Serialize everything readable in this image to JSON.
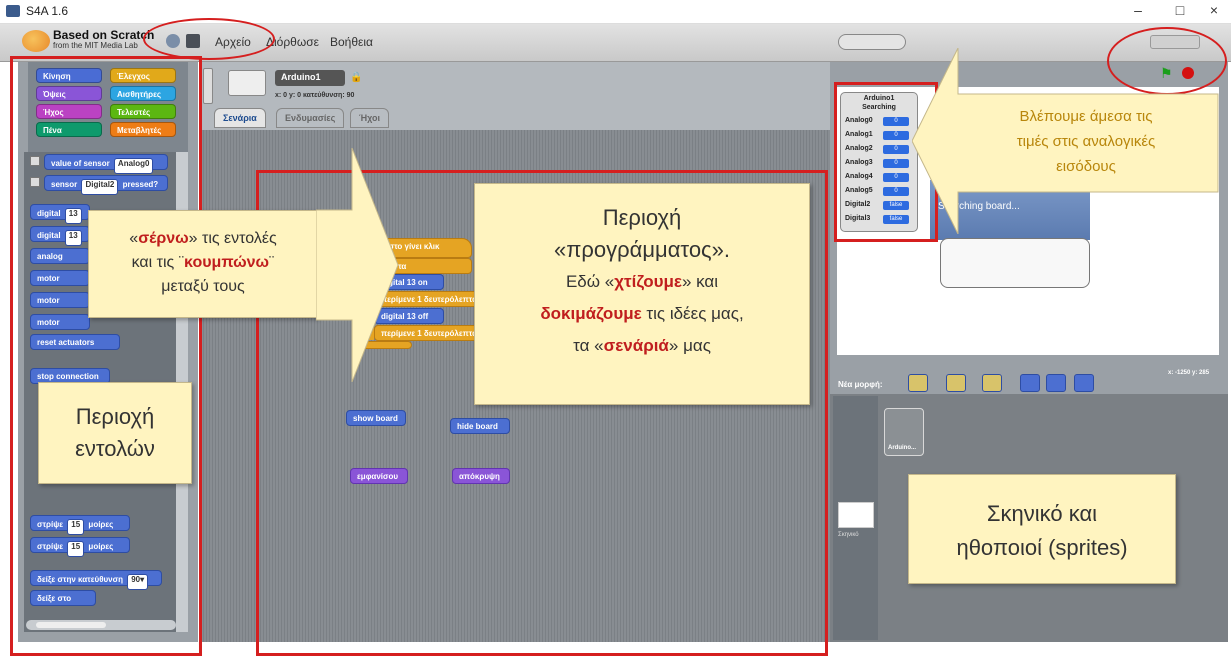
{
  "window": {
    "title": "S4A 1.6",
    "minimize": "–",
    "maximize": "□",
    "close": "×"
  },
  "menubar": {
    "logo_line1": "Based on Scratch",
    "logo_line2": "from the MIT Media Lab",
    "items": [
      "Αρχείο",
      "Διόρθωσε",
      "Βοήθεια"
    ]
  },
  "categories": [
    {
      "label": "Κίνηση",
      "color": "#4a6cd4"
    },
    {
      "label": "Έλεγχος",
      "color": "#e1a91a"
    },
    {
      "label": "Όψεις",
      "color": "#8a55d7"
    },
    {
      "label": "Αισθητήρες",
      "color": "#2ca5e2"
    },
    {
      "label": "Ήχος",
      "color": "#bb42c3"
    },
    {
      "label": "Τελεστές",
      "color": "#5cb712"
    },
    {
      "label": "Πένα",
      "color": "#0e9a6c"
    },
    {
      "label": "Μεταβλητές",
      "color": "#ee7d16"
    }
  ],
  "palette_blocks": [
    {
      "text": "value of sensor",
      "arg": "Analog0",
      "kind": "checkbox"
    },
    {
      "text": "sensor",
      "arg": "Digital2",
      "suffix": "pressed?",
      "kind": "checkbox"
    },
    {
      "text": "digital",
      "arg": "13"
    },
    {
      "text": "digital",
      "arg": "13"
    },
    {
      "text": "analog"
    },
    {
      "text": "motor"
    },
    {
      "text": "motor"
    },
    {
      "text": "motor"
    },
    {
      "text": "reset actuators"
    },
    {
      "text": "stop connection"
    },
    {
      "text": "στρίψε",
      "arg": "15",
      "suffix": "μοίρες"
    },
    {
      "text": "στρίψε",
      "arg": "15",
      "suffix": "μοίρες"
    },
    {
      "text": "δείξε στην κατεύθυνση",
      "arg": "90▾"
    },
    {
      "text": "δείξε στο"
    }
  ],
  "sprite": {
    "name": "Arduino1",
    "coords": "x: 0    y: 0    κατεύθυνση: 90"
  },
  "tabs": [
    "Σενάρια",
    "Ενδυμασίες",
    "Ήχοι"
  ],
  "script_blocks": {
    "hat": "όταν στο   γίνει κλικ",
    "forever": "για πάντα",
    "d_on": "digital  13  on",
    "wait1": "περίμενε  1  δευτερόλεπτα",
    "d_off": "digital  13  off",
    "wait2": "περίμενε  1  δευτερόλεπτα",
    "show_board": "show board",
    "hide_board": "hide board",
    "show": "εμφανίσου",
    "hide": "απόκρυψη"
  },
  "sensor_board": {
    "title1": "Arduino1",
    "title2": "Searching",
    "rows": [
      {
        "label": "Analog0",
        "value": "0"
      },
      {
        "label": "Analog1",
        "value": "0"
      },
      {
        "label": "Analog2",
        "value": "0"
      },
      {
        "label": "Analog3",
        "value": "0"
      },
      {
        "label": "Analog4",
        "value": "0"
      },
      {
        "label": "Analog5",
        "value": "0"
      },
      {
        "label": "Digital2",
        "value": "false"
      },
      {
        "label": "Digital3",
        "value": "false"
      }
    ]
  },
  "board_panel": {
    "title": "Arduino1",
    "status": "Searching board..."
  },
  "sprite_panel": {
    "new_sprite_label": "Νέα μορφή:",
    "coords": "x: -1250  y: 285",
    "sprite_item": "Arduino...",
    "stage_label": "Σκηνικό"
  },
  "callouts": {
    "drag": {
      "l1a": "«",
      "l1b": "σέρνω",
      "l1c": "» τις εντολές",
      "l2a": "και τις ¨",
      "l2b": "κουμπώνω",
      "l2c": "¨",
      "l3": "μεταξύ τους"
    },
    "commands": {
      "l1": "Περιοχή",
      "l2": "εντολών"
    },
    "program": {
      "l1": "Περιοχή",
      "l2": "«προγράμματος».",
      "l3a": "Εδώ «",
      "l3b": "χτίζουμε",
      "l3c": "» και",
      "l4a": "δοκιμάζουμε",
      "l4b": " τις ιδέες μας,",
      "l5a": "τα «",
      "l5b": "σενάριά",
      "l5c": "» μας"
    },
    "values": {
      "l1": "Βλέπουμε άμεσα τις",
      "l2": "τιμές στις αναλογικές",
      "l3": "εισόδους"
    },
    "stage": {
      "l1": "Σκηνικό  και",
      "l2": "ηθοποιοί (sprites)"
    }
  },
  "colors": {
    "highlight": "#d51f1f",
    "callout_bg": "#fff4c0"
  }
}
